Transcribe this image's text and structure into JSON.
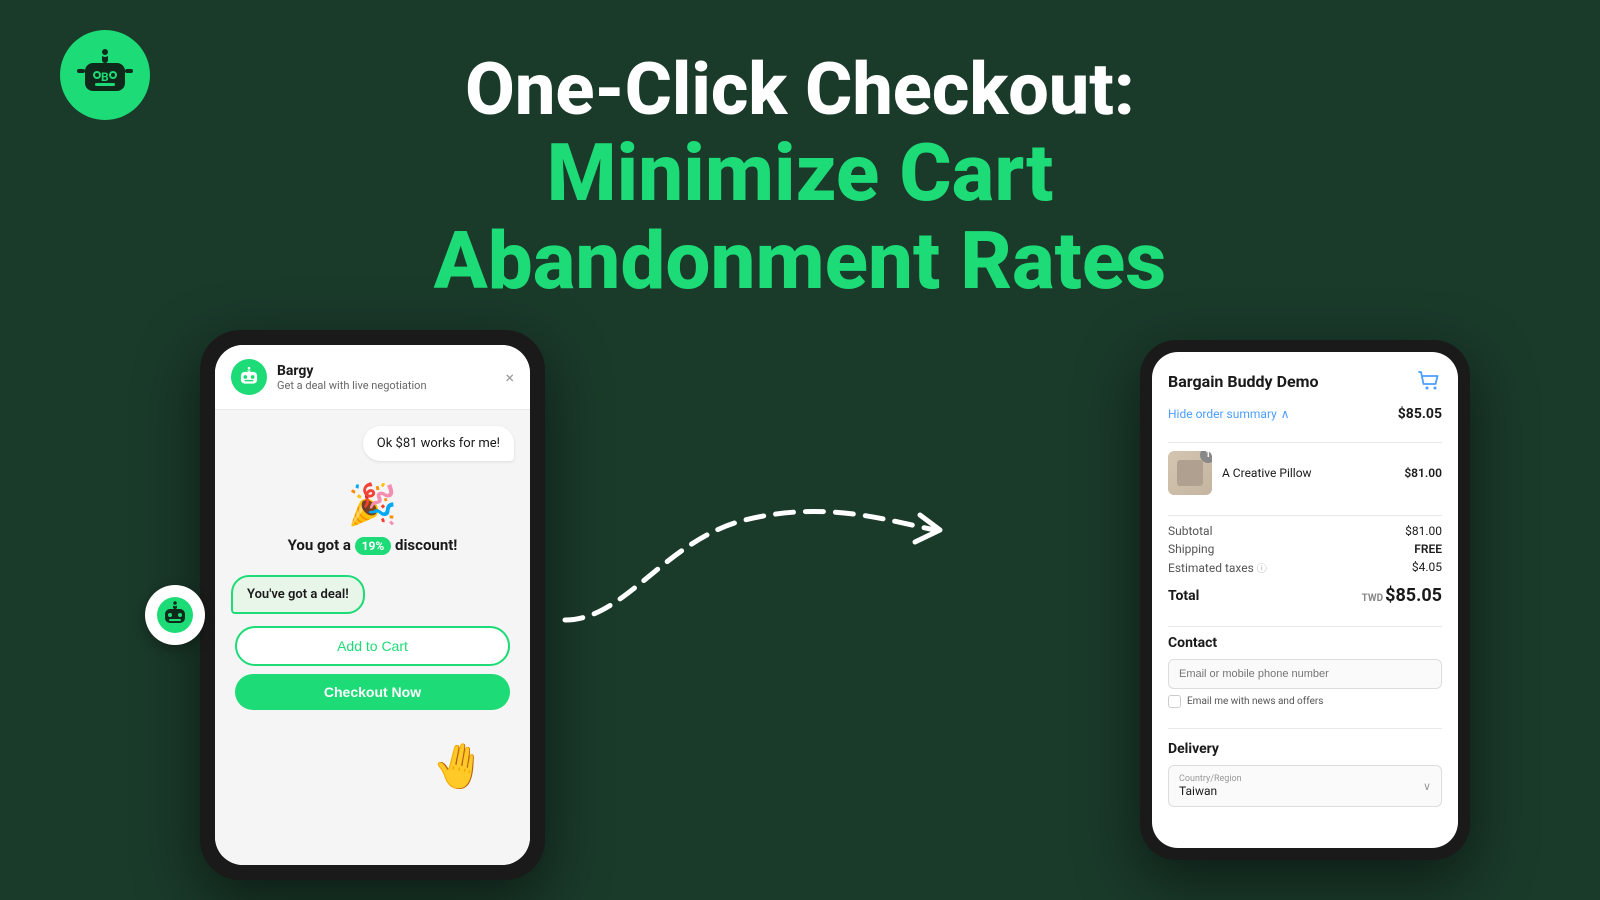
{
  "page": {
    "background_color": "#1a3a2a",
    "title": "One-Click Checkout: Minimize Cart Abandonment Rates"
  },
  "header": {
    "logo_color": "#1ddb76",
    "logo_letter": "B"
  },
  "hero": {
    "title_line1": "One-Click Checkout:",
    "title_line2": "Minimize Cart",
    "title_line3": "Abandonment Rates"
  },
  "left_phone": {
    "chat_title": "Bargy",
    "chat_subtitle": "Get a deal with live negotiation",
    "close_label": "×",
    "bubble_ok": "Ok $81 works for me!",
    "discount_emoji": "🎉",
    "discount_text_pre": "You got a",
    "discount_percent": "19%",
    "discount_text_post": "discount!",
    "deal_bubble": "You've got a deal!",
    "btn_add_cart": "Add to Cart",
    "btn_checkout": "Checkout Now"
  },
  "right_phone": {
    "store_name": "Bargain Buddy Demo",
    "order_summary_label": "Hide order summary",
    "order_total_top": "$85.05",
    "product_name": "A Creative Pillow",
    "product_price": "$81.00",
    "product_qty": "1",
    "subtotal_label": "Subtotal",
    "subtotal_value": "$81.00",
    "shipping_label": "Shipping",
    "shipping_value": "FREE",
    "taxes_label": "Estimated taxes",
    "taxes_value": "$4.05",
    "total_label": "Total",
    "total_currency": "TWD",
    "total_value": "$85.05",
    "contact_section": "Contact",
    "contact_placeholder": "Email or mobile phone number",
    "newsletter_label": "Email me with news and offers",
    "delivery_section": "Delivery",
    "country_label": "Country/Region",
    "country_value": "Taiwan"
  }
}
